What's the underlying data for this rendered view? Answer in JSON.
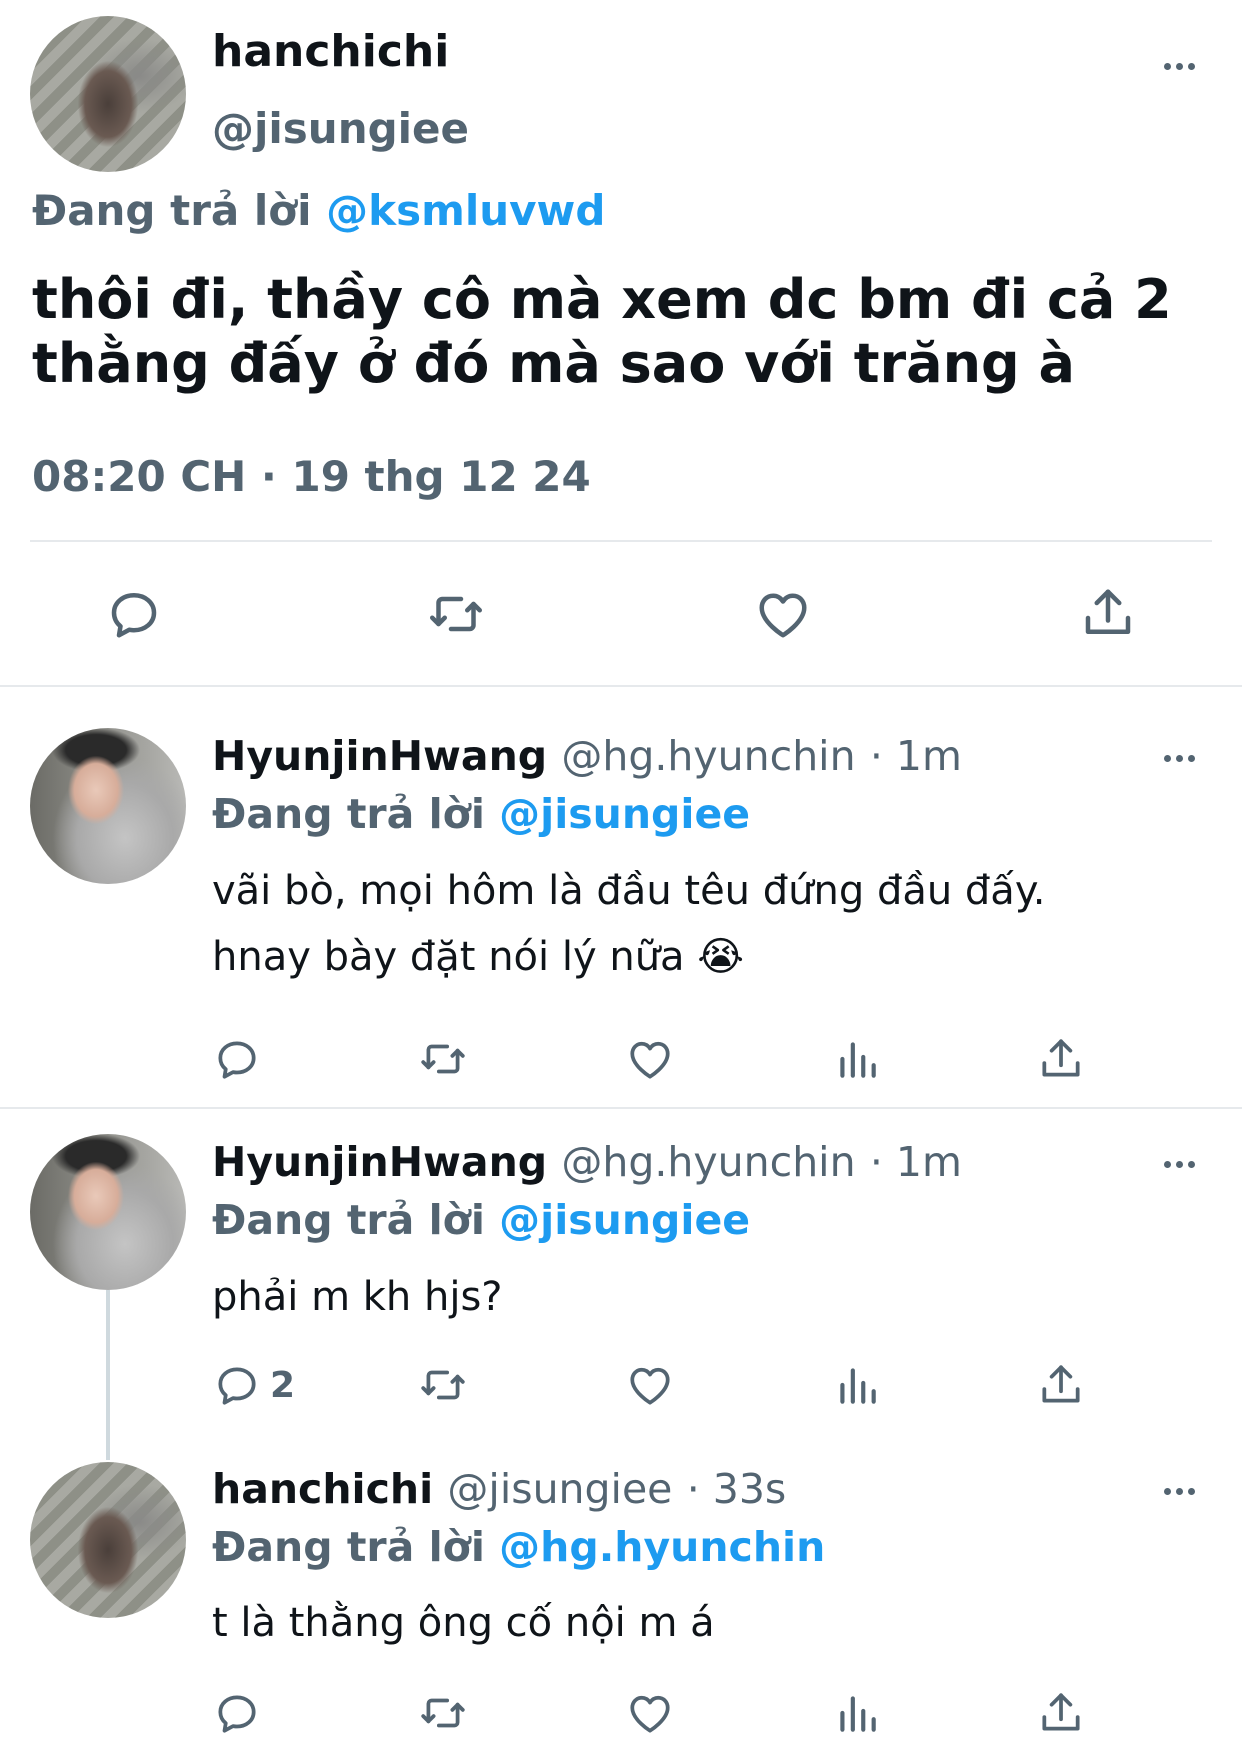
{
  "main_tweet": {
    "name": "hanchichi",
    "handle": "@jisungiee",
    "replying_prefix": "Đang trả lời",
    "replying_to": "@ksmluvwd",
    "text": "thôi đi, thầy cô mà xem dc bm đi cả 2 thằng đấy ở đó mà sao với trăng à",
    "timestamp": "08:20 CH · 19 thg 12 24",
    "icons": [
      "reply-icon",
      "retweet-icon",
      "like-icon",
      "share-icon"
    ]
  },
  "replies": [
    {
      "name": "HyunjinHwang",
      "handle": "@hg.hyunchin",
      "time": "· 1m",
      "replying_prefix": "Đang trả lời",
      "replying_to": "@jisungiee",
      "text_line1": "vãi bò, mọi hôm là đầu têu đứng đầu đấy.",
      "text_line2": "hnay bày đặt nói lý nữa",
      "emoji": "😭",
      "reply_count": ""
    },
    {
      "name": "HyunjinHwang",
      "handle": "@hg.hyunchin",
      "time": "· 1m",
      "replying_prefix": "Đang trả lời",
      "replying_to": "@jisungiee",
      "text_line1": "phải m kh hjs?",
      "reply_count": "2"
    },
    {
      "name": "hanchichi",
      "handle": "@jisungiee",
      "time": "· 33s",
      "replying_prefix": "Đang trả lời",
      "replying_to": "@hg.hyunchin",
      "text_line1": "t là thằng ông cố nội m á",
      "reply_count": ""
    }
  ],
  "colors": {
    "accent": "#1d9bf0",
    "secondary_text": "#536471",
    "divider": "#e6e9ec"
  }
}
